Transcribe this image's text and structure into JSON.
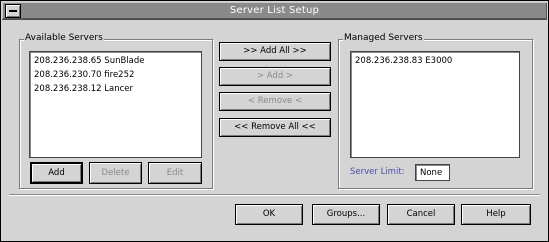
{
  "window": {
    "title": "Server List Setup"
  },
  "available": {
    "label": "Available Servers",
    "items": [
      "208.236.238.65 SunBlade",
      "208.236.230.70 fire252",
      "208.236.238.12 Lancer"
    ],
    "add_label": "Add",
    "delete_label": "Delete",
    "edit_label": "Edit"
  },
  "transfer": {
    "add_all": ">> Add All >>",
    "add": "> Add >",
    "remove": "< Remove <",
    "remove_all": "<< Remove All <<"
  },
  "managed": {
    "label": "Managed Servers",
    "items": [
      "208.236.238.83 E3000"
    ],
    "limit_label": "Server Limit:",
    "limit_value": "None"
  },
  "footer": {
    "ok": "OK",
    "groups": "Groups...",
    "cancel": "Cancel",
    "help": "Help"
  }
}
